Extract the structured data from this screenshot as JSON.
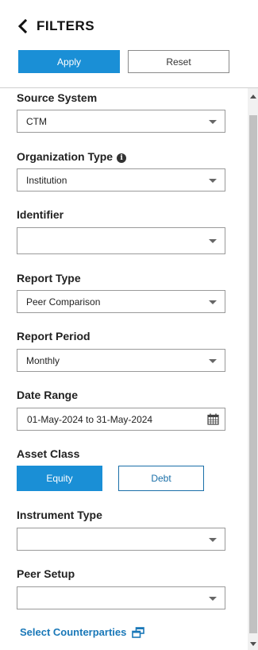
{
  "header": {
    "title": "FILTERS",
    "apply_label": "Apply",
    "reset_label": "Reset"
  },
  "filters": {
    "source_system": {
      "label": "Source System",
      "value": "CTM"
    },
    "organization_type": {
      "label": "Organization Type",
      "value": "Institution",
      "info": "i"
    },
    "identifier": {
      "label": "Identifier",
      "value": ""
    },
    "report_type": {
      "label": "Report Type",
      "value": "Peer Comparison"
    },
    "report_period": {
      "label": "Report Period",
      "value": "Monthly"
    },
    "date_range": {
      "label": "Date Range",
      "value": "01-May-2024 to 31-May-2024"
    },
    "asset_class": {
      "label": "Asset Class",
      "options": [
        "Equity",
        "Debt"
      ],
      "selected": "Equity"
    },
    "instrument_type": {
      "label": "Instrument Type",
      "value": ""
    },
    "peer_setup": {
      "label": "Peer Setup",
      "value": ""
    }
  },
  "select_counterparties_label": "Select Counterparties",
  "colors": {
    "primary": "#1a8fd6",
    "link": "#1a78b8",
    "border": "#9a9a9a"
  }
}
